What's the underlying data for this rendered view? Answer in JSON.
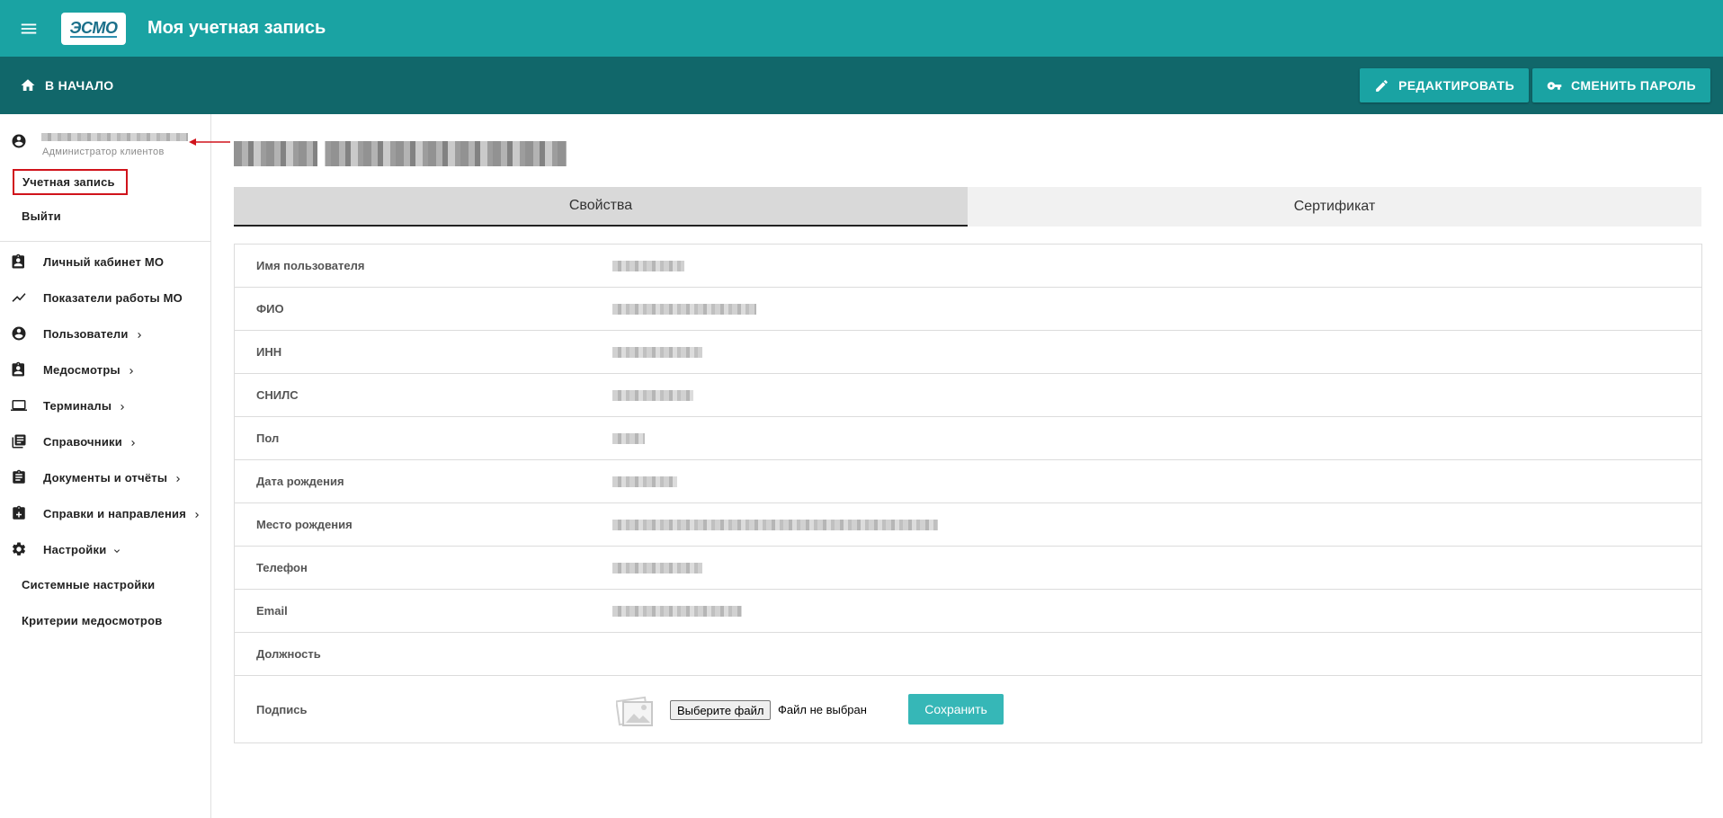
{
  "app": {
    "logo_text": "ЭСМО",
    "title": "Моя учетная запись",
    "brand_color": "#1aa3a3",
    "toolbar_color": "#11676a"
  },
  "toolbar": {
    "home_label": "В НАЧАЛО",
    "edit_label": "РЕДАКТИРОВАТЬ",
    "change_password_label": "СМЕНИТЬ ПАРОЛЬ"
  },
  "sidebar": {
    "user_role": "Администратор клиентов",
    "account_link": "Учетная запись",
    "logout_link": "Выйти",
    "items": [
      {
        "label": "Личный кабинет МО",
        "icon": "badge-icon",
        "has_chevron": false
      },
      {
        "label": "Показатели работы МО",
        "icon": "trending-icon",
        "has_chevron": false
      },
      {
        "label": "Пользователи",
        "icon": "account-circle-icon",
        "has_chevron": true
      },
      {
        "label": "Медосмотры",
        "icon": "medical-badge-icon",
        "has_chevron": true
      },
      {
        "label": "Терминалы",
        "icon": "laptop-icon",
        "has_chevron": true
      },
      {
        "label": "Справочники",
        "icon": "library-books-icon",
        "has_chevron": true
      },
      {
        "label": "Документы и отчёты",
        "icon": "clipboard-icon",
        "has_chevron": true
      },
      {
        "label": "Справки и направления",
        "icon": "medical-clipboard-icon",
        "has_chevron": true
      },
      {
        "label": "Настройки",
        "icon": "gear-icon",
        "has_chevron": true,
        "expanded": true
      }
    ],
    "settings_sub": [
      "Системные настройки",
      "Критерии медосмотров"
    ]
  },
  "main": {
    "tabs": [
      {
        "label": "Свойства",
        "active": true
      },
      {
        "label": "Сертификат",
        "active": false
      }
    ],
    "properties": [
      {
        "label": "Имя пользователя"
      },
      {
        "label": "ФИО"
      },
      {
        "label": "ИНН"
      },
      {
        "label": "СНИЛС"
      },
      {
        "label": "Пол"
      },
      {
        "label": "Дата рождения"
      },
      {
        "label": "Место рождения"
      },
      {
        "label": "Телефон"
      },
      {
        "label": "Email"
      },
      {
        "label": "Должность"
      }
    ],
    "signature": {
      "label": "Подпись",
      "file_button": "Выберите файл",
      "file_status": "Файл не выбран",
      "save_button": "Сохранить"
    }
  }
}
